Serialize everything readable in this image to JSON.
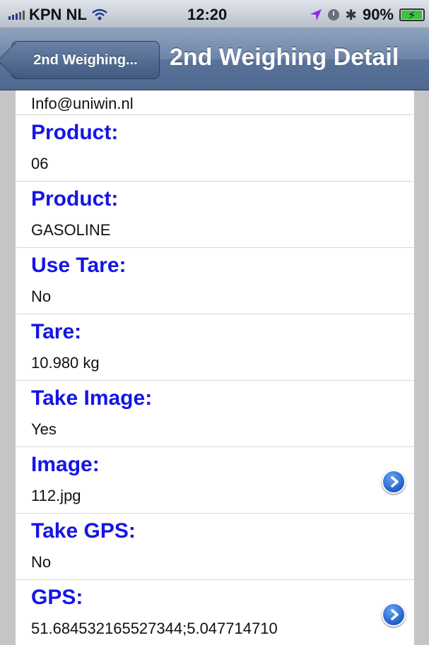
{
  "status_bar": {
    "carrier": "KPN NL",
    "time": "12:20",
    "battery": "90%",
    "icons": [
      "signal-icon",
      "wifi-icon",
      "location-icon",
      "clock-icon",
      "bluetooth-icon",
      "battery-icon"
    ]
  },
  "nav_bar": {
    "back_label": "2nd Weighing...",
    "title": "2nd Weighing Detail"
  },
  "first_row_value": "Info@uniwin.nl",
  "fields": [
    {
      "label": "Product:",
      "value": "06",
      "disclosure": false
    },
    {
      "label": "Product:",
      "value": "GASOLINE",
      "disclosure": false
    },
    {
      "label": "Use Tare:",
      "value": "No",
      "disclosure": false
    },
    {
      "label": "Tare:",
      "value": "10.980 kg",
      "disclosure": false
    },
    {
      "label": "Take Image:",
      "value": "Yes",
      "disclosure": false
    },
    {
      "label": "Image:",
      "value": "112.jpg",
      "disclosure": true
    },
    {
      "label": "Take GPS:",
      "value": "No",
      "disclosure": false
    },
    {
      "label": "GPS:",
      "value": "51.684532165527344;5.047714710",
      "disclosure": true
    }
  ],
  "colors": {
    "label": "#1515e6",
    "nav": "#5a7399",
    "disclosure": "#1f5fc9"
  }
}
